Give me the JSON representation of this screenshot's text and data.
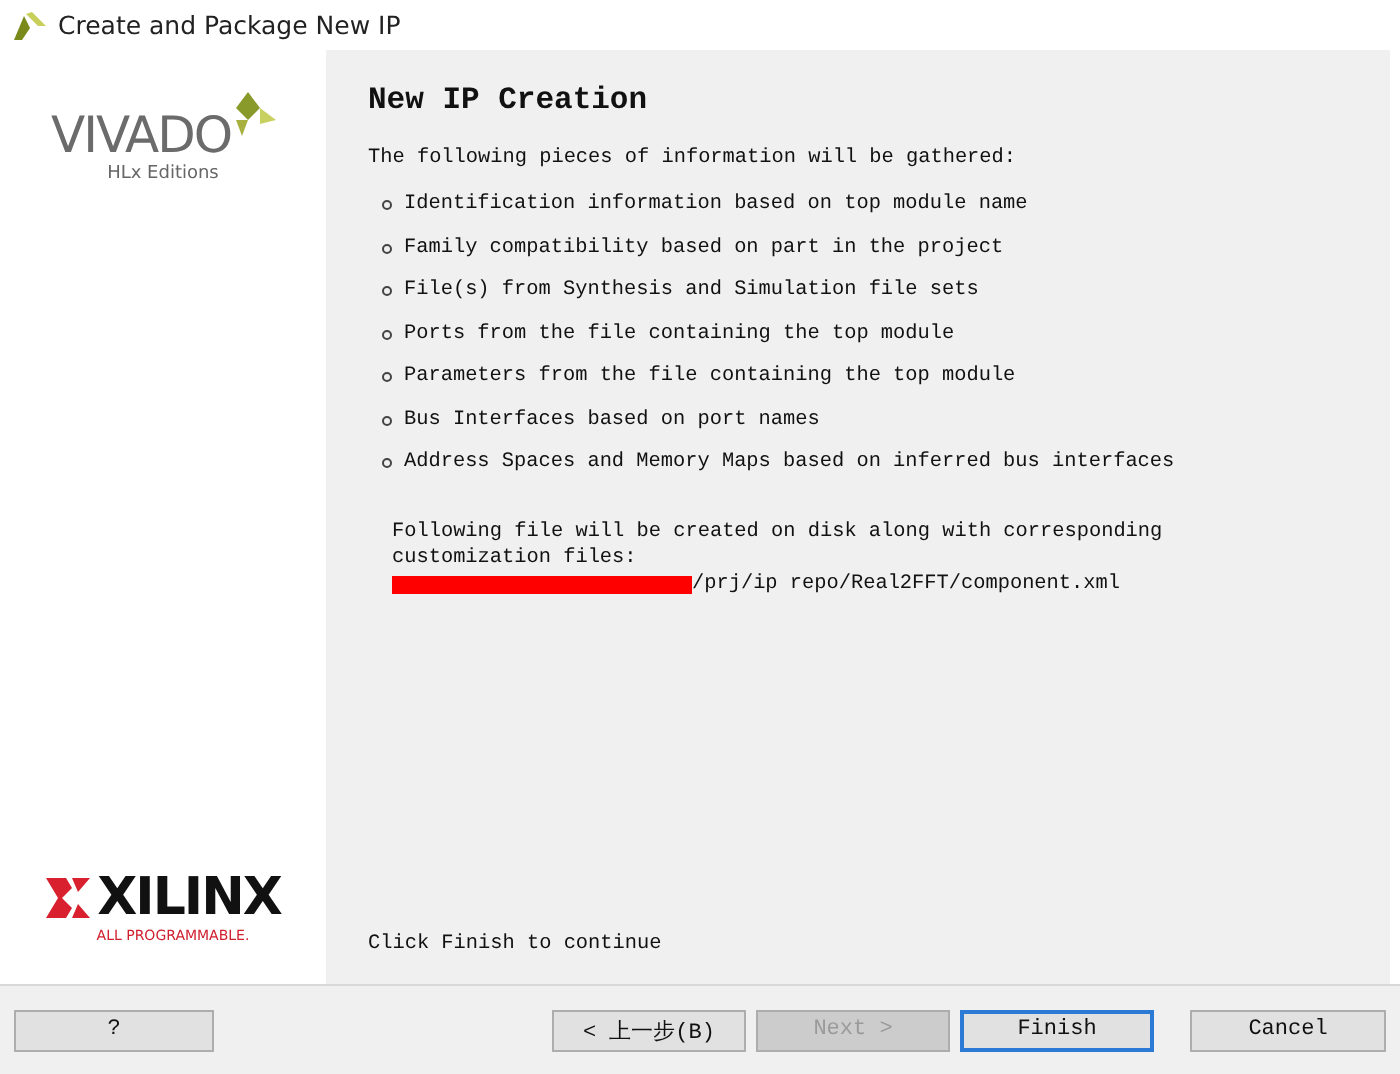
{
  "window": {
    "title": "Create and Package New IP"
  },
  "sidebar": {
    "product_logo": {
      "name": "VIVADO",
      "edition": "HLx Editions"
    },
    "company_logo": {
      "name": "XILINX",
      "tagline": "ALL PROGRAMMABLE."
    }
  },
  "page": {
    "heading": "New IP Creation",
    "intro": "The following pieces of information will be gathered:",
    "items": [
      "Identification information based on top module name",
      "Family compatibility based on part in the project",
      "File(s) from Synthesis and Simulation file sets",
      "Ports from the file containing the top module",
      "Parameters from the file containing the top module",
      "Bus Interfaces based on port names",
      "Address Spaces and Memory Maps based on inferred bus interfaces"
    ],
    "file_note": "Following file will be created on disk along with corresponding customization files:",
    "file_path": "/prj/ip repo/Real2FFT/component.xml",
    "footer": "Click Finish to continue"
  },
  "buttons": [
    {
      "label": "?",
      "kind": "help",
      "disabled": false,
      "focused": false
    },
    {
      "label": "< 上一步(B)",
      "kind": "nav",
      "disabled": false,
      "focused": false
    },
    {
      "label": "Next >",
      "kind": "nav",
      "disabled": true,
      "focused": false
    },
    {
      "label": "Finish",
      "kind": "nav",
      "disabled": false,
      "focused": true
    },
    {
      "label": "Cancel",
      "kind": "cancel",
      "disabled": false,
      "focused": false
    }
  ]
}
